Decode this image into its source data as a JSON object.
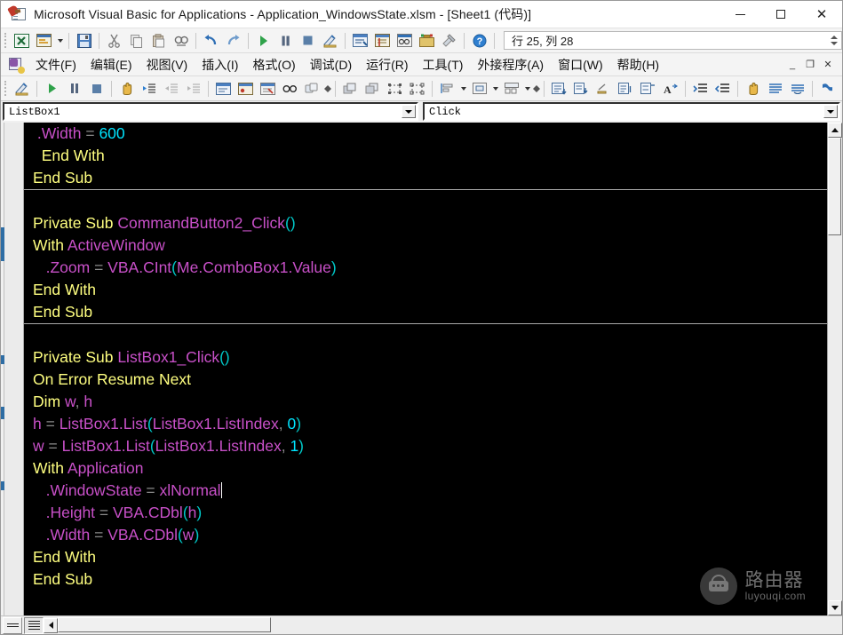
{
  "window": {
    "title": "Microsoft Visual Basic for Applications - Application_WindowsState.xlsm - [Sheet1 (代码)]",
    "icon": "vba-document-icon",
    "minimize_label": "",
    "maximize_label": "",
    "close_label": "✕"
  },
  "standard_toolbar": {
    "buttons": [
      {
        "name": "view-excel-icon",
        "glyph": "excel"
      },
      {
        "name": "insert-userform-icon",
        "glyph": "userform"
      },
      {
        "name": "save-icon",
        "glyph": "save"
      },
      {
        "name": "cut-icon",
        "glyph": "cut"
      },
      {
        "name": "copy-icon",
        "glyph": "copy"
      },
      {
        "name": "paste-icon",
        "glyph": "paste"
      },
      {
        "name": "find-icon",
        "glyph": "find"
      },
      {
        "name": "undo-icon",
        "glyph": "undo"
      },
      {
        "name": "redo-icon",
        "glyph": "redo"
      },
      {
        "name": "run-icon",
        "glyph": "run"
      },
      {
        "name": "pause-icon",
        "glyph": "pause"
      },
      {
        "name": "reset-icon",
        "glyph": "stop"
      },
      {
        "name": "design-mode-icon",
        "glyph": "design"
      },
      {
        "name": "project-explorer-icon",
        "glyph": "project"
      },
      {
        "name": "properties-window-icon",
        "glyph": "properties"
      },
      {
        "name": "object-browser-icon",
        "glyph": "objbrowser"
      },
      {
        "name": "toolbox-icon",
        "glyph": "toolbox"
      },
      {
        "name": "help-icon",
        "glyph": "help"
      }
    ],
    "position_indicator": "行 25, 列 28"
  },
  "menubar": {
    "icon": "vba-project-icon",
    "items": [
      {
        "label": "文件(F)",
        "key": "F"
      },
      {
        "label": "编辑(E)",
        "key": "E"
      },
      {
        "label": "视图(V)",
        "key": "V"
      },
      {
        "label": "插入(I)",
        "key": "I"
      },
      {
        "label": "格式(O)",
        "key": "O"
      },
      {
        "label": "调试(D)",
        "key": "D"
      },
      {
        "label": "运行(R)",
        "key": "R"
      },
      {
        "label": "工具(T)",
        "key": "T"
      },
      {
        "label": "外接程序(A)",
        "key": "A"
      },
      {
        "label": "窗口(W)",
        "key": "W"
      },
      {
        "label": "帮助(H)",
        "key": "H"
      }
    ],
    "mdi_buttons": [
      {
        "name": "mdi-minimize-button",
        "glyph": "_"
      },
      {
        "name": "mdi-restore-button",
        "glyph": "❐"
      },
      {
        "name": "mdi-close-button",
        "glyph": "✕"
      }
    ]
  },
  "edit_toolbar": {
    "buttons": [
      {
        "name": "design-mode-icon"
      },
      {
        "name": "run-sub-icon"
      },
      {
        "name": "break-icon"
      },
      {
        "name": "reset-icon"
      },
      {
        "name": "drag-hand-icon"
      },
      {
        "name": "indent-icon"
      },
      {
        "name": "outdent-left-icon"
      },
      {
        "name": "outdent-right-icon"
      },
      {
        "name": "toggle-breakpoint-icon"
      },
      {
        "name": "comment-block-icon"
      },
      {
        "name": "uncomment-block-icon"
      },
      {
        "name": "toggle-bookmark-icon"
      },
      {
        "name": "next-bookmark-icon"
      },
      {
        "name": "bring-to-front-icon"
      },
      {
        "name": "send-to-back-icon"
      },
      {
        "name": "group-icon"
      },
      {
        "name": "ungroup-icon"
      },
      {
        "name": "align-icon"
      },
      {
        "name": "center-icon"
      },
      {
        "name": "size-icon"
      },
      {
        "name": "quick-info-icon"
      },
      {
        "name": "parameter-info-icon"
      },
      {
        "name": "complete-word-icon"
      },
      {
        "name": "list-constants-icon"
      },
      {
        "name": "indent-block-icon"
      },
      {
        "name": "outdent-block-icon"
      },
      {
        "name": "hand-tool-icon"
      },
      {
        "name": "list-properties-icon"
      },
      {
        "name": "toggle-folder-icon"
      },
      {
        "name": "bookmark-blue-icon"
      },
      {
        "name": "bookmark-next-icon"
      },
      {
        "name": "bookmark-prev-icon"
      },
      {
        "name": "clear-bookmarks-icon"
      }
    ]
  },
  "combos": {
    "object": {
      "value": "ListBox1",
      "name": "object-combo"
    },
    "procedure": {
      "value": "Click",
      "name": "procedure-combo"
    }
  },
  "code": {
    "lines": [
      {
        "sep": false,
        "indent": 0,
        "tokens": [
          {
            "t": " ",
            "c": "plain"
          },
          {
            "t": ".Width",
            "c": "id"
          },
          {
            "t": " = ",
            "c": "op"
          },
          {
            "t": "600",
            "c": "num"
          }
        ]
      },
      {
        "sep": false,
        "indent": 0,
        "tokens": [
          {
            "t": "  End With",
            "c": "kw"
          }
        ]
      },
      {
        "sep": false,
        "indent": 0,
        "tokens": [
          {
            "t": "End Sub",
            "c": "kw"
          }
        ]
      },
      {
        "sep": true,
        "indent": 0,
        "tokens": []
      },
      {
        "sep": false,
        "indent": 0,
        "tokens": []
      },
      {
        "sep": false,
        "indent": 0,
        "tokens": [
          {
            "t": "Private Sub ",
            "c": "kw"
          },
          {
            "t": "CommandButton2_Click",
            "c": "id"
          },
          {
            "t": "()",
            "c": "paren"
          }
        ]
      },
      {
        "sep": false,
        "indent": 0,
        "tokens": [
          {
            "t": "With ",
            "c": "kw"
          },
          {
            "t": "ActiveWindow",
            "c": "id"
          }
        ]
      },
      {
        "sep": false,
        "indent": 0,
        "tokens": [
          {
            "t": "   ",
            "c": "plain"
          },
          {
            "t": ".Zoom",
            "c": "id"
          },
          {
            "t": " = ",
            "c": "op"
          },
          {
            "t": "VBA",
            "c": "id"
          },
          {
            "t": ".",
            "c": "id"
          },
          {
            "t": "CInt",
            "c": "id"
          },
          {
            "t": "(",
            "c": "paren"
          },
          {
            "t": "Me",
            "c": "id"
          },
          {
            "t": ".",
            "c": "id"
          },
          {
            "t": "ComboBox1",
            "c": "id"
          },
          {
            "t": ".",
            "c": "id"
          },
          {
            "t": "Value",
            "c": "id"
          },
          {
            "t": ")",
            "c": "paren"
          }
        ]
      },
      {
        "sep": false,
        "indent": 0,
        "tokens": [
          {
            "t": "End With",
            "c": "kw"
          }
        ]
      },
      {
        "sep": false,
        "indent": 0,
        "tokens": [
          {
            "t": "End Sub",
            "c": "kw"
          }
        ]
      },
      {
        "sep": true,
        "indent": 0,
        "tokens": []
      },
      {
        "sep": false,
        "indent": 0,
        "tokens": []
      },
      {
        "sep": false,
        "indent": 0,
        "tokens": [
          {
            "t": "Private Sub ",
            "c": "kw"
          },
          {
            "t": "ListBox1_Click",
            "c": "id"
          },
          {
            "t": "()",
            "c": "paren"
          }
        ]
      },
      {
        "sep": false,
        "indent": 0,
        "tokens": [
          {
            "t": "On Error Resume Next",
            "c": "kw"
          }
        ]
      },
      {
        "sep": false,
        "indent": 0,
        "tokens": [
          {
            "t": "Dim ",
            "c": "kw"
          },
          {
            "t": "w",
            "c": "id"
          },
          {
            "t": ", ",
            "c": "op"
          },
          {
            "t": "h",
            "c": "id"
          }
        ]
      },
      {
        "sep": false,
        "indent": 0,
        "tokens": [
          {
            "t": "h",
            "c": "id"
          },
          {
            "t": " = ",
            "c": "op"
          },
          {
            "t": "ListBox1",
            "c": "id"
          },
          {
            "t": ".",
            "c": "id"
          },
          {
            "t": "List",
            "c": "id"
          },
          {
            "t": "(",
            "c": "paren"
          },
          {
            "t": "ListBox1",
            "c": "id"
          },
          {
            "t": ".",
            "c": "id"
          },
          {
            "t": "ListIndex",
            "c": "id"
          },
          {
            "t": ", ",
            "c": "op"
          },
          {
            "t": "0",
            "c": "num"
          },
          {
            "t": ")",
            "c": "paren"
          }
        ]
      },
      {
        "sep": false,
        "indent": 0,
        "tokens": [
          {
            "t": "w",
            "c": "id"
          },
          {
            "t": " = ",
            "c": "op"
          },
          {
            "t": "ListBox1",
            "c": "id"
          },
          {
            "t": ".",
            "c": "id"
          },
          {
            "t": "List",
            "c": "id"
          },
          {
            "t": "(",
            "c": "paren"
          },
          {
            "t": "ListBox1",
            "c": "id"
          },
          {
            "t": ".",
            "c": "id"
          },
          {
            "t": "ListIndex",
            "c": "id"
          },
          {
            "t": ", ",
            "c": "op"
          },
          {
            "t": "1",
            "c": "num"
          },
          {
            "t": ")",
            "c": "paren"
          }
        ]
      },
      {
        "sep": false,
        "indent": 0,
        "tokens": [
          {
            "t": "With ",
            "c": "kw"
          },
          {
            "t": "Application",
            "c": "id"
          }
        ]
      },
      {
        "sep": false,
        "indent": 0,
        "tokens": [
          {
            "t": "   ",
            "c": "plain"
          },
          {
            "t": ".WindowState",
            "c": "id"
          },
          {
            "t": " = ",
            "c": "op"
          },
          {
            "t": "xlNormal",
            "c": "id"
          },
          {
            "t": "|CARET|",
            "c": "caret"
          }
        ]
      },
      {
        "sep": false,
        "indent": 0,
        "tokens": [
          {
            "t": "   ",
            "c": "plain"
          },
          {
            "t": ".Height",
            "c": "id"
          },
          {
            "t": " = ",
            "c": "op"
          },
          {
            "t": "VBA",
            "c": "id"
          },
          {
            "t": ".",
            "c": "id"
          },
          {
            "t": "CDbl",
            "c": "id"
          },
          {
            "t": "(",
            "c": "paren"
          },
          {
            "t": "h",
            "c": "id"
          },
          {
            "t": ")",
            "c": "paren"
          }
        ]
      },
      {
        "sep": false,
        "indent": 0,
        "tokens": [
          {
            "t": "   ",
            "c": "plain"
          },
          {
            "t": ".Width",
            "c": "id"
          },
          {
            "t": " = ",
            "c": "op"
          },
          {
            "t": "VBA",
            "c": "id"
          },
          {
            "t": ".",
            "c": "id"
          },
          {
            "t": "CDbl",
            "c": "id"
          },
          {
            "t": "(",
            "c": "paren"
          },
          {
            "t": "w",
            "c": "id"
          },
          {
            "t": ")",
            "c": "paren"
          }
        ]
      },
      {
        "sep": false,
        "indent": 0,
        "tokens": [
          {
            "t": "End With",
            "c": "kw"
          }
        ]
      },
      {
        "sep": false,
        "indent": 0,
        "tokens": [
          {
            "t": "End Sub",
            "c": "kw"
          }
        ]
      }
    ]
  },
  "watermark": {
    "cn": "路由器",
    "en": "luyouqi.com",
    "icon": "router-icon"
  },
  "bottom": {
    "procedure_view_name": "procedure-view-button",
    "full_module_view_name": "full-module-view-button"
  },
  "colors": {
    "code_background": "#000000",
    "keyword": "#ffff80",
    "identifier": "#c850c8",
    "number": "#00e5ff",
    "operator": "#8a8a8a",
    "paren": "#00c8c8",
    "title_bar": "#ffffff",
    "toolbar": "#f4f4f4",
    "accent_blue": "#2e6da4"
  }
}
